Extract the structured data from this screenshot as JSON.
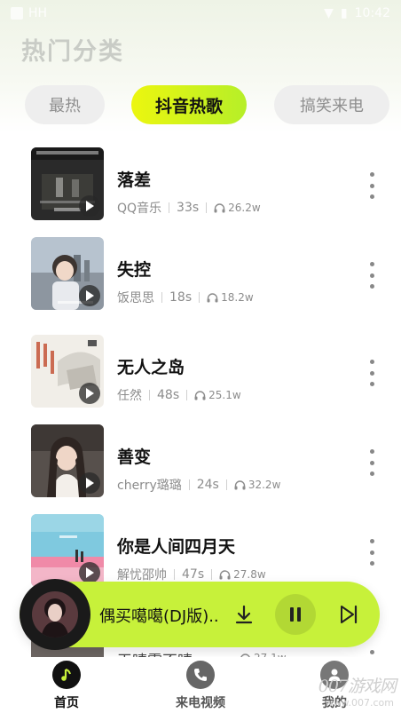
{
  "status_bar": {
    "left": "HH",
    "right": "10:42"
  },
  "page": {
    "title": "热门分类"
  },
  "tabs": [
    {
      "label": "最热",
      "active": false
    },
    {
      "label": "抖音热歌",
      "active": true
    },
    {
      "label": "搞笑来电",
      "active": false
    }
  ],
  "songs": [
    {
      "title": "落差",
      "artist": "QQ音乐",
      "duration": "33s",
      "plays": "26.2w"
    },
    {
      "title": "失控",
      "artist": "饭思思",
      "duration": "18s",
      "plays": "18.2w"
    },
    {
      "title": "无人之岛",
      "artist": "任然",
      "duration": "48s",
      "plays": "25.1w"
    },
    {
      "title": "善变",
      "artist": "cherry璐璐",
      "duration": "24s",
      "plays": "32.2w"
    },
    {
      "title": "你是人间四月天",
      "artist": "解忧邵帅",
      "duration": "47s",
      "plays": "27.8w"
    },
    {
      "title": "天晴需不晴",
      "artist": "",
      "duration": "",
      "plays": "27.1w"
    }
  ],
  "player": {
    "title": "偶买噶噶(DJ版)..",
    "state": "playing"
  },
  "bottom_nav": [
    {
      "label": "首页",
      "icon": "music-note-icon",
      "active": true
    },
    {
      "label": "来电视频",
      "icon": "phone-icon",
      "active": false
    },
    {
      "label": "我的",
      "icon": "user-icon",
      "active": false
    }
  ],
  "colors": {
    "accent": "#c7f13a",
    "tab_gradient_start": "#ecf60f",
    "tab_gradient_end": "#b6ef28"
  },
  "watermark": {
    "main": "007游戏网",
    "sub": "www.007.com"
  }
}
